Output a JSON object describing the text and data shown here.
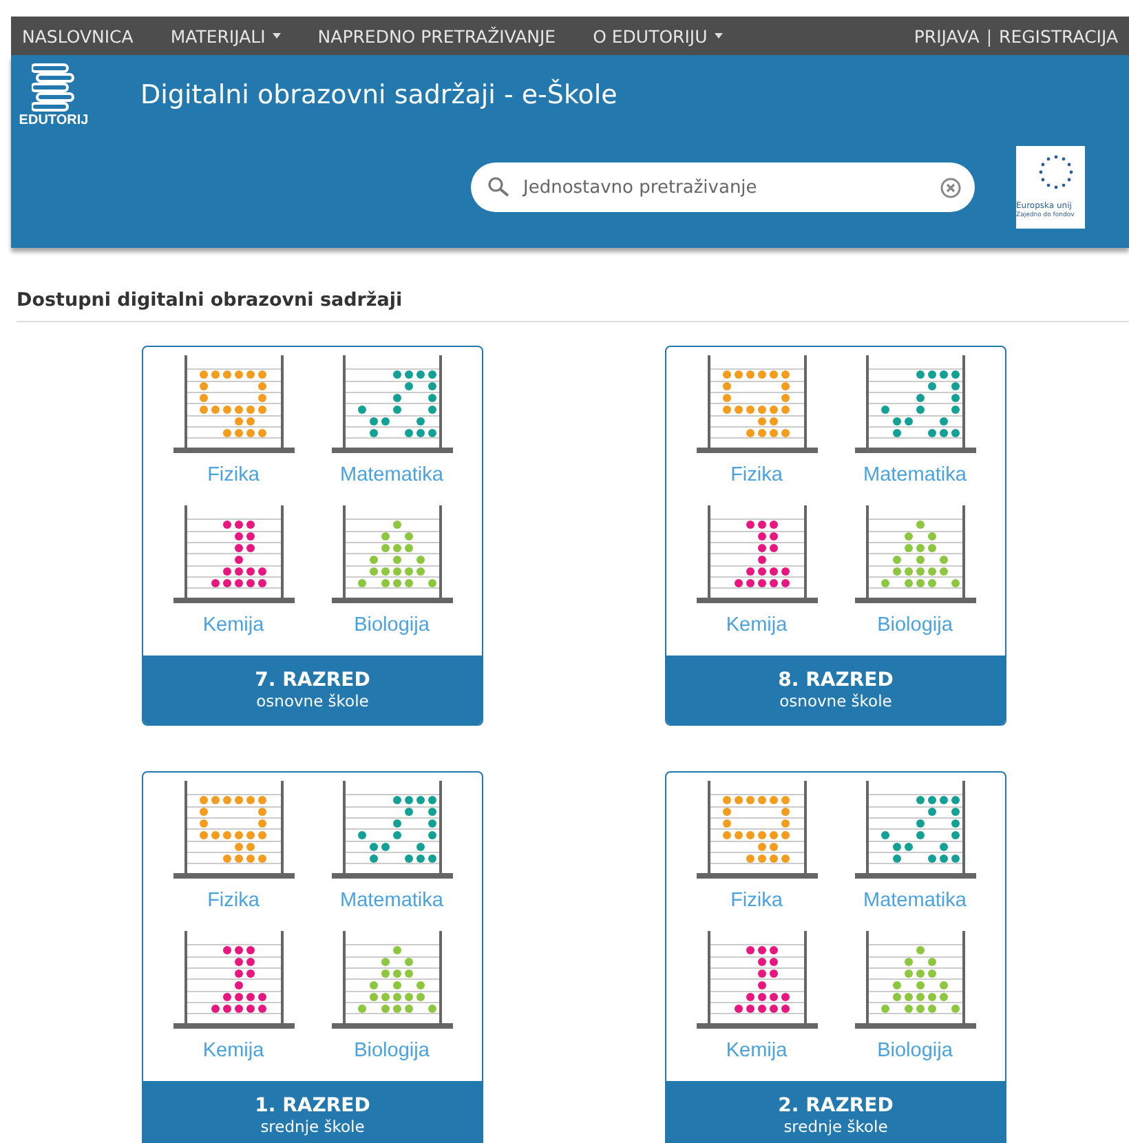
{
  "nav": {
    "items": [
      {
        "label": "NASLOVNICA",
        "dropdown": false
      },
      {
        "label": "MATERIJALI",
        "dropdown": true
      },
      {
        "label": "NAPREDNO PRETRAŽIVANJE",
        "dropdown": false
      },
      {
        "label": "O EDUTORIJU",
        "dropdown": true
      }
    ],
    "login": "PRIJAVA",
    "separator": "|",
    "register": "REGISTRACIJA"
  },
  "banner": {
    "logo_text": "EDUTORIJ",
    "title": "Digitalni obrazovni sadržaji - e-Škole",
    "search": {
      "placeholder": "Jednostavno pretraživanje"
    },
    "eu": {
      "line_1": "Europska unij",
      "line_2": "Zajedno do fondov"
    }
  },
  "section_title": "Dostupni digitalni obrazovni sadržaji",
  "cards": [
    {
      "title": "7. RAZRED",
      "subtitle": "osnovne škole",
      "subjects": [
        {
          "label": "Fizika",
          "color": "#f39c1e"
        },
        {
          "label": "Matematika",
          "color": "#13a195"
        },
        {
          "label": "Kemija",
          "color": "#e8177f"
        },
        {
          "label": "Biologija",
          "color": "#8dc63f"
        }
      ]
    },
    {
      "title": "8. RAZRED",
      "subtitle": "osnovne škole",
      "subjects": [
        {
          "label": "Fizika",
          "color": "#f39c1e"
        },
        {
          "label": "Matematika",
          "color": "#13a195"
        },
        {
          "label": "Kemija",
          "color": "#e8177f"
        },
        {
          "label": "Biologija",
          "color": "#8dc63f"
        }
      ]
    },
    {
      "title": "1. RAZRED",
      "subtitle": "srednje škole",
      "subjects": [
        {
          "label": "Fizika",
          "color": "#f39c1e"
        },
        {
          "label": "Matematika",
          "color": "#13a195"
        },
        {
          "label": "Kemija",
          "color": "#e8177f"
        },
        {
          "label": "Biologija",
          "color": "#8dc63f"
        }
      ]
    },
    {
      "title": "2. RAZRED",
      "subtitle": "srednje škole",
      "subjects": [
        {
          "label": "Fizika",
          "color": "#f39c1e"
        },
        {
          "label": "Matematika",
          "color": "#13a195"
        },
        {
          "label": "Kemija",
          "color": "#e8177f"
        },
        {
          "label": "Biologija",
          "color": "#8dc63f"
        }
      ]
    }
  ]
}
